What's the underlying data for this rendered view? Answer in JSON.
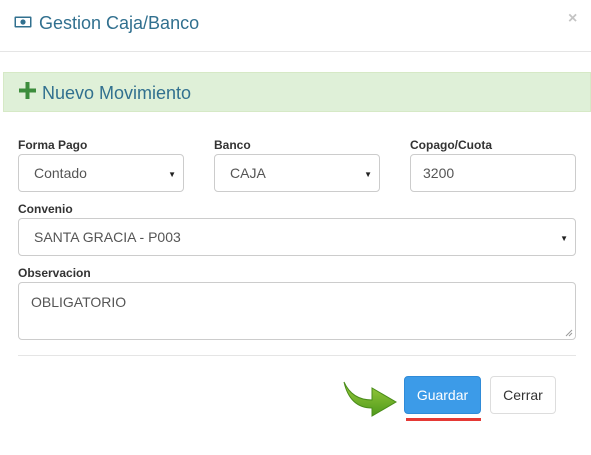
{
  "header": {
    "title": "Gestion Caja/Banco",
    "title_icon": "money-icon",
    "close_label": "×"
  },
  "panel": {
    "title": "Nuevo Movimiento",
    "icon": "plus-icon",
    "accent": "#3c8d3c"
  },
  "form": {
    "forma_pago": {
      "label": "Forma Pago",
      "value": "Contado"
    },
    "banco": {
      "label": "Banco",
      "value": "CAJA"
    },
    "copago": {
      "label": "Copago/Cuota",
      "value": "3200"
    },
    "convenio": {
      "label": "Convenio",
      "value": "SANTA GRACIA - P003"
    },
    "observacion": {
      "label": "Observacion",
      "value": "OBLIGATORIO"
    }
  },
  "footer": {
    "save_label": "Guardar",
    "close_label": "Cerrar",
    "primary_color": "#3c9be8",
    "highlight_color": "#e53935"
  }
}
